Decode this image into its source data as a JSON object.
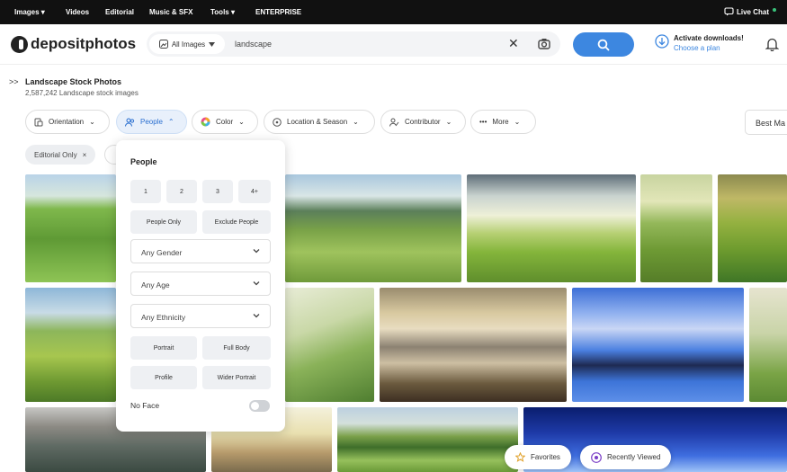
{
  "topnav": {
    "items": [
      "Images ▾",
      "Videos",
      "Editorial",
      "Music & SFX",
      "Tools ▾",
      "ENTERPRISE"
    ],
    "live_chat": "Live Chat"
  },
  "header": {
    "logo_text": "depositphotos",
    "scope_label": "All Images",
    "search_value": "landscape",
    "activate_title": "Activate downloads!",
    "activate_link": "Choose a plan"
  },
  "results": {
    "title": "Landscape Stock Photos",
    "count": "2,587,242 Landscape stock images"
  },
  "filters": {
    "items": [
      "Orientation",
      "People",
      "Color",
      "Location & Season",
      "Contributor",
      "More"
    ],
    "sort": "Best Ma"
  },
  "chips": [
    "Editorial Only"
  ],
  "people_panel": {
    "title": "People",
    "counts": [
      "1",
      "2",
      "3",
      "4+"
    ],
    "only": [
      "People Only",
      "Exclude People"
    ],
    "gender": "Any Gender",
    "age": "Any Age",
    "ethnicity": "Any Ethnicity",
    "shots": [
      "Portrait",
      "Full Body",
      "Profile",
      "Wider Portrait"
    ],
    "no_face": "No Face"
  },
  "floating": {
    "favorites": "Favorites",
    "recently_viewed": "Recently Viewed"
  },
  "colors": {
    "accent": "#3d87e0",
    "topbar": "#111111"
  }
}
